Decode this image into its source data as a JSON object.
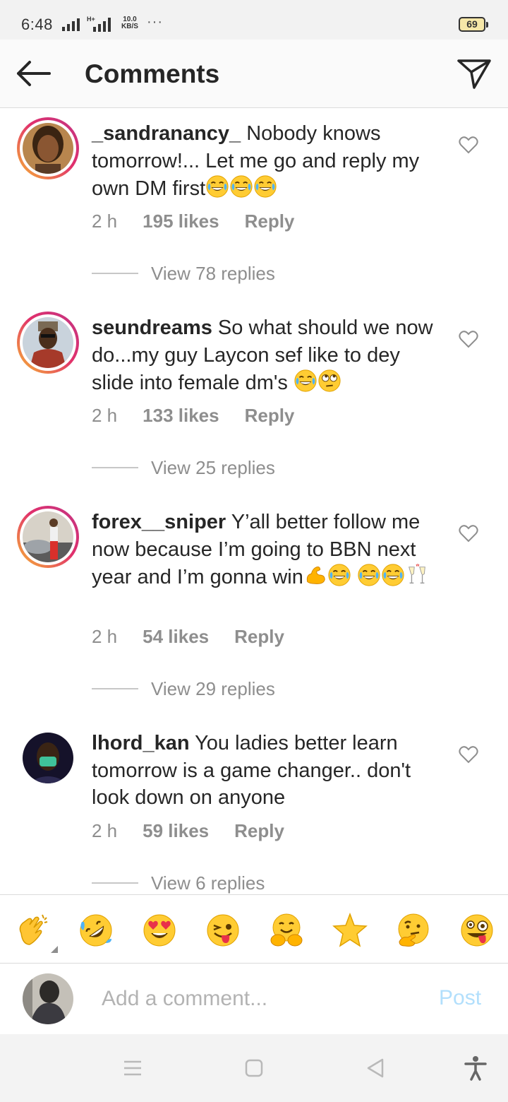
{
  "status_bar": {
    "time": "6:48",
    "speed_value": "10.0",
    "speed_unit": "KB/S",
    "more": "···",
    "network_type": "H+",
    "battery": "69"
  },
  "header": {
    "title": "Comments",
    "back_icon": "arrow-left-icon",
    "send_icon": "paper-plane-icon"
  },
  "comments": [
    {
      "username": "_sandranancy_",
      "text": " Nobody knows tomorrow!... Let me go and reply my own DM first",
      "emojis": [
        "face-with-tears-of-joy",
        "face-with-tears-of-joy",
        "face-with-tears-of-joy"
      ],
      "time": "2 h",
      "likes": "195 likes",
      "reply": "Reply",
      "view_replies": "View 78 replies"
    },
    {
      "username": "seundreams",
      "text": " So what should we now do...my guy Laycon sef like to dey slide into female dm's ",
      "emojis": [
        "face-with-tears-of-joy",
        "face-with-rolling-eyes"
      ],
      "time": "2 h",
      "likes": "133 likes",
      "reply": "Reply",
      "view_replies": "View 25 replies"
    },
    {
      "username": "forex__sniper",
      "text": " Y’all better follow me now because I’m going to BBN next year and I’m gonna win",
      "emojis": [
        "flexed-biceps",
        "face-with-tears-of-joy",
        "face-with-tears-of-joy",
        "face-with-tears-of-joy",
        "clinking-glasses"
      ],
      "time": "2 h",
      "likes": "54 likes",
      "reply": "Reply",
      "view_replies": "View 29 replies"
    },
    {
      "username": "lhord_kan",
      "text": " You ladies better learn tomorrow is a game changer.. don't look down on anyone",
      "emojis": [],
      "time": "2 h",
      "likes": "59 likes",
      "reply": "Reply",
      "view_replies": "View 6 replies"
    }
  ],
  "reactions": [
    "clapping-hands",
    "rolling-on-floor-laughing",
    "heart-eyes",
    "winking-tongue",
    "hugging-face",
    "star",
    "thinking-face",
    "zany-face"
  ],
  "add_comment": {
    "placeholder": "Add a comment...",
    "post_label": "Post"
  },
  "colors": {
    "text": "#262626",
    "secondary": "#8e8e8e",
    "post_disabled": "#b2dffc",
    "story_ring_start": "#f7b733",
    "story_ring_end": "#c13584"
  },
  "nav_bar": [
    "menu-icon",
    "home-square-icon",
    "back-triangle-icon",
    "accessibility-icon"
  ]
}
